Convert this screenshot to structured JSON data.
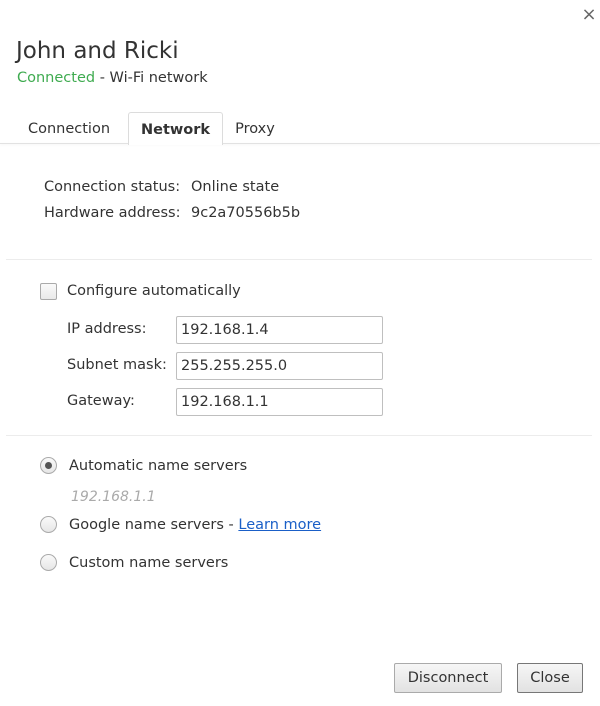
{
  "dialog": {
    "close_icon": "×",
    "title": "John and Ricki",
    "status": "Connected",
    "status_color": "#3fab50",
    "subtitle_rest": " - Wi-Fi network"
  },
  "tabs": [
    {
      "label": "Connection",
      "active": false
    },
    {
      "label": "Network",
      "active": true
    },
    {
      "label": "Proxy",
      "active": false
    }
  ],
  "info": {
    "connection_status_label": "Connection status:",
    "connection_status_value": "Online state",
    "hardware_address_label": "Hardware address:",
    "hardware_address_value": "9c2a70556b5b"
  },
  "ip_config": {
    "configure_automatically_label": "Configure automatically",
    "configure_automatically_checked": false,
    "fields": [
      {
        "label": "IP address:",
        "value": "192.168.1.4"
      },
      {
        "label": "Subnet mask:",
        "value": "255.255.255.0"
      },
      {
        "label": "Gateway:",
        "value": "192.168.1.1"
      }
    ]
  },
  "name_servers": {
    "options": [
      {
        "label": "Automatic name servers",
        "selected": true
      },
      {
        "label": "Google name servers - ",
        "link": "Learn more",
        "selected": false
      },
      {
        "label": "Custom name servers",
        "selected": false
      }
    ],
    "automatic_hint": "192.168.1.1",
    "link_color": "#1a5fc7"
  },
  "buttons": {
    "disconnect": "Disconnect",
    "close": "Close"
  }
}
